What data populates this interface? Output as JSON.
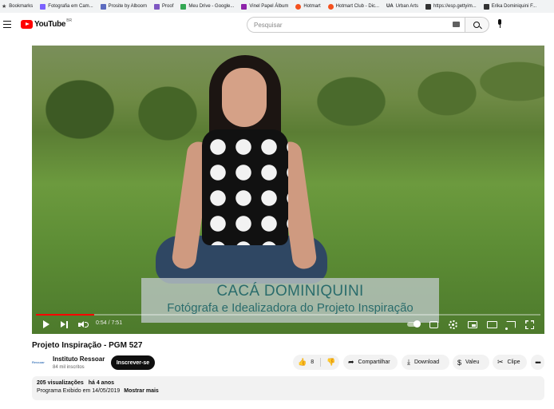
{
  "bookmarks": [
    {
      "label": "Bookmarks",
      "icon": "star-icon",
      "color": "#444444"
    },
    {
      "label": "Fotografia em Cam...",
      "icon": "site-icon",
      "color": "#7b61ff"
    },
    {
      "label": "Prosite by Alboom",
      "icon": "site-icon",
      "color": "#5c6bc0"
    },
    {
      "label": "Proof",
      "icon": "site-icon",
      "color": "#7e57c2"
    },
    {
      "label": "Meu Drive - Google...",
      "icon": "drive-icon",
      "color": "#34a853"
    },
    {
      "label": "Vinel Papel Álbum",
      "icon": "site-icon",
      "color": "#8e24aa"
    },
    {
      "label": "Hotmart",
      "icon": "flame-icon",
      "color": "#f4511e"
    },
    {
      "label": "Hotmart Club - Dic...",
      "icon": "flame-icon",
      "color": "#f4511e"
    },
    {
      "label": "Urban Arts",
      "icon": "ua-icon",
      "color": "#222222"
    },
    {
      "label": "https://esp.gettyim...",
      "icon": "site-icon",
      "color": "#333333"
    },
    {
      "label": "Erika Dominiquini F...",
      "icon": "site-icon",
      "color": "#333333"
    }
  ],
  "masthead": {
    "logo_text": "YouTube",
    "country_code": "BR",
    "search_placeholder": "Pesquisar"
  },
  "video": {
    "lower_third_name": "CACÁ DOMINIQUINI",
    "lower_third_role": "Fotógrafa e Idealizadora do Projeto Inspiração",
    "time_display": "0:54 / 7:51",
    "progress_fraction": 0.115
  },
  "info": {
    "title": "Projeto Inspiração - PGM 527",
    "channel_name": "Instituto Ressoar",
    "channel_logo_text": "Ressoar",
    "subscribers": "84 mil inscritos",
    "subscribe_label": "Inscrever-se",
    "like_count": "8",
    "share_label": "Compartilhar",
    "download_label": "Download",
    "thanks_label": "Valeu",
    "clip_label": "Clipe",
    "more_label": "•••"
  },
  "description": {
    "views": "205 visualizações",
    "date": "há 4 anos",
    "text": "Programa Exibido em 14/05/2019",
    "show_more": "Mostrar mais"
  },
  "colors": {
    "brand_red": "#ff0000",
    "subscribe_bg": "#0f0f0f",
    "lower_third_text": "#2a6c6c"
  }
}
